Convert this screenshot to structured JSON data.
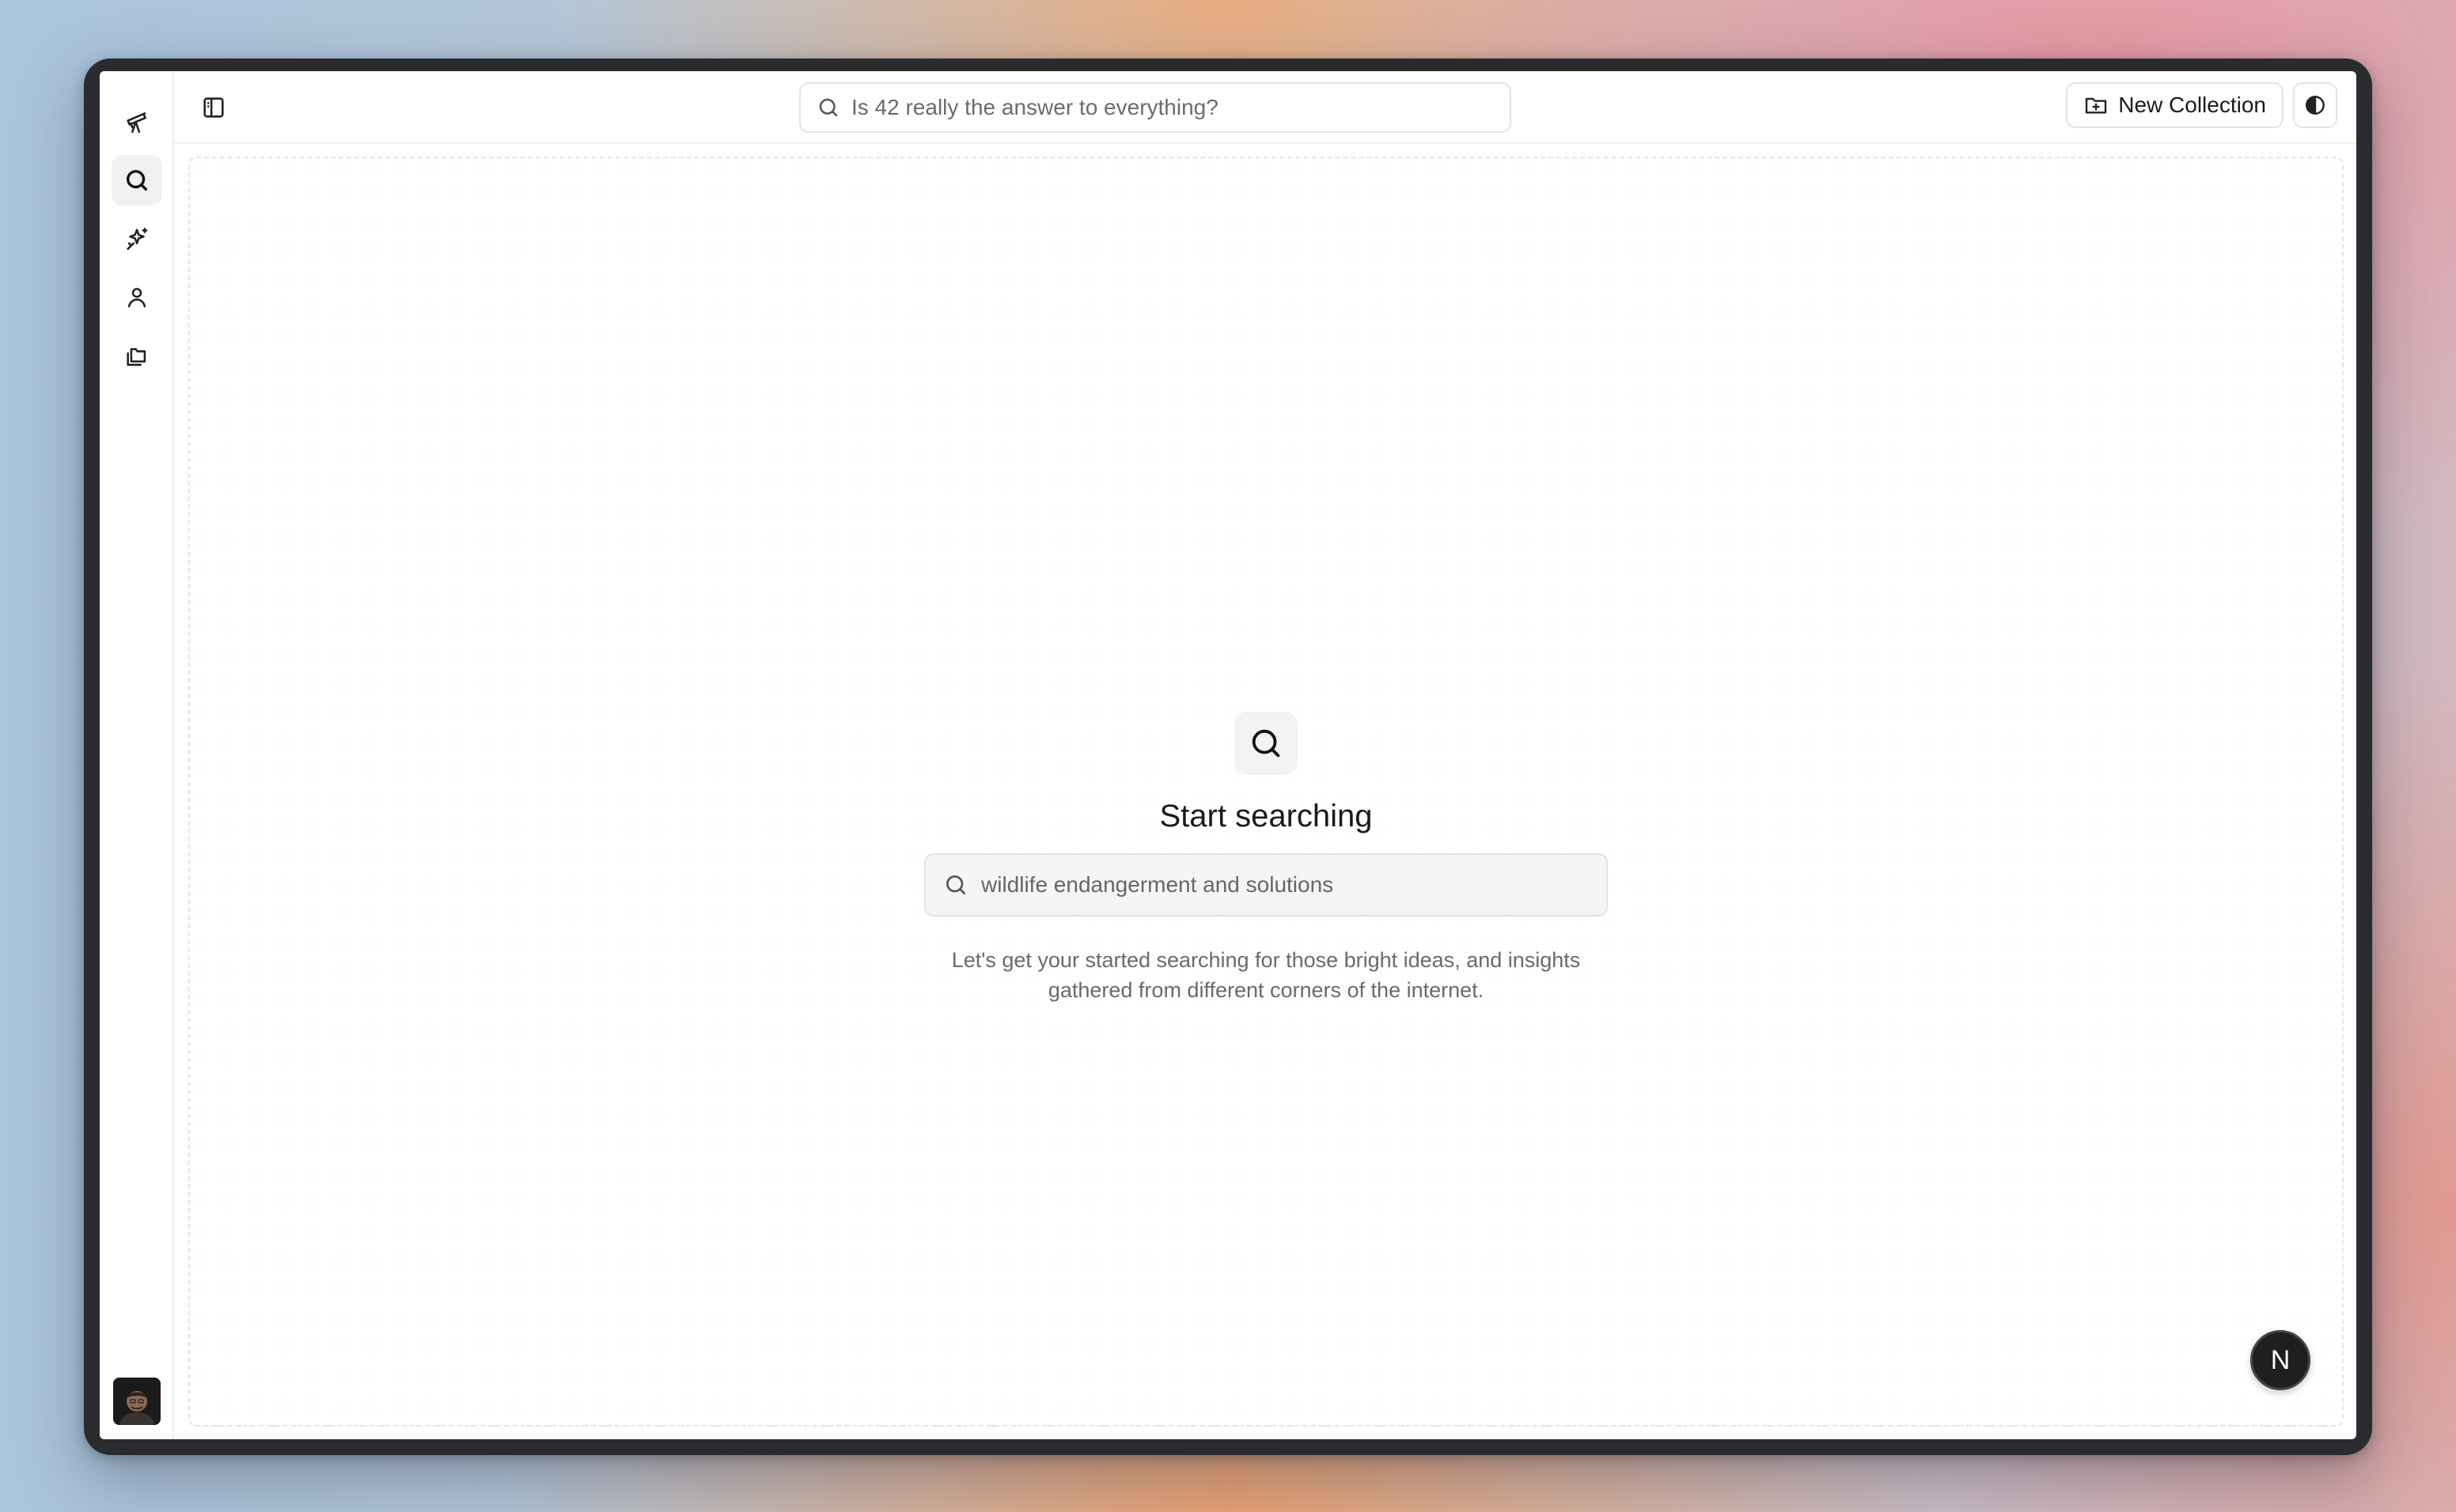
{
  "top_search": {
    "placeholder": "Is 42 really the answer to everything?"
  },
  "header": {
    "new_collection_label": "New Collection"
  },
  "rail": {
    "items": [
      {
        "icon": "telescope-icon",
        "active": false
      },
      {
        "icon": "search-icon",
        "active": true
      },
      {
        "icon": "sparkles-icon",
        "active": false
      },
      {
        "icon": "user-icon",
        "active": false
      },
      {
        "icon": "collections-icon",
        "active": false
      }
    ]
  },
  "main": {
    "title": "Start searching",
    "search_placeholder": "wildlife endangerment and solutions",
    "description": "Let's get your started searching for those bright ideas, and insights gathered from different corners of the internet."
  },
  "fab": {
    "label": "N"
  },
  "colors": {
    "accent_dark": "#1f1f1f",
    "text": "#1a1a1a",
    "muted": "#6a6a6a"
  }
}
